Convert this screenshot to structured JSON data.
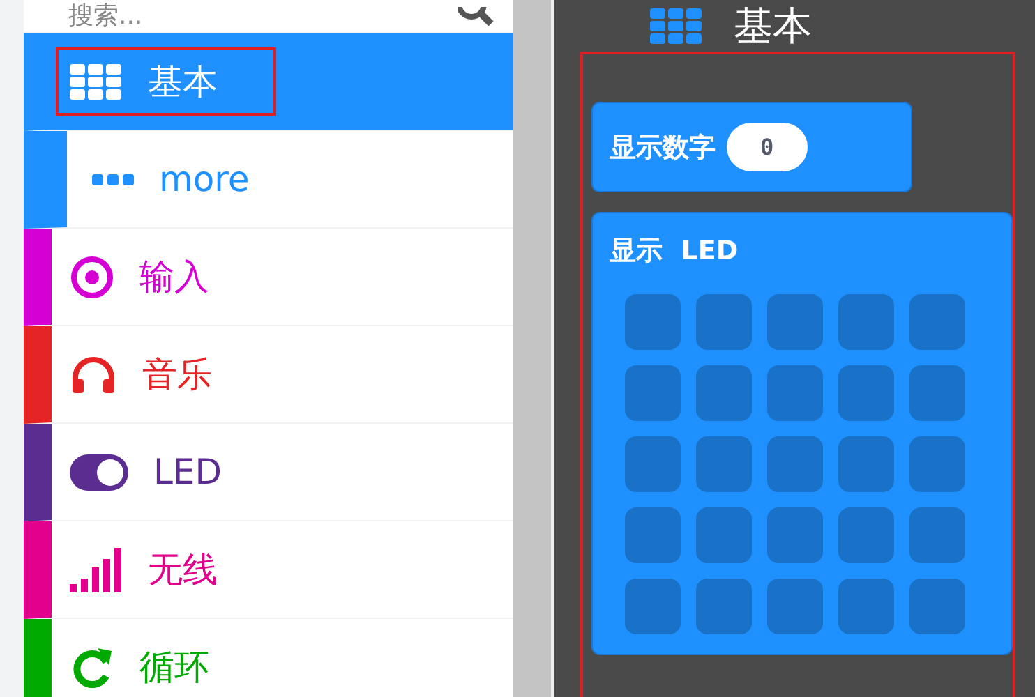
{
  "search": {
    "placeholder": "搜索..."
  },
  "categories": [
    {
      "label": "基本",
      "kind": "grid",
      "color": "#1e90ff",
      "selected": true,
      "sub": false,
      "highlighted": true
    },
    {
      "label": "more",
      "kind": "dots",
      "color": "#1e90ff",
      "selected": false,
      "sub": true,
      "highlighted": false
    },
    {
      "label": "输入",
      "kind": "target",
      "color": "#d400d4",
      "selected": false,
      "sub": false,
      "highlighted": false
    },
    {
      "label": "音乐",
      "kind": "headphones",
      "color": "#e52525",
      "selected": false,
      "sub": false,
      "highlighted": false
    },
    {
      "label": "LED",
      "kind": "toggle",
      "color": "#5c2d91",
      "selected": false,
      "sub": false,
      "highlighted": false
    },
    {
      "label": "无线",
      "kind": "signal",
      "color": "#e3008c",
      "selected": false,
      "sub": false,
      "highlighted": false
    },
    {
      "label": "循环",
      "kind": "refresh",
      "color": "#00aa00",
      "selected": false,
      "sub": false,
      "highlighted": false
    }
  ],
  "flyout": {
    "title": "基本",
    "highlighted": true,
    "blocks": [
      {
        "kind": "number",
        "label": "显示数字",
        "value": "0"
      },
      {
        "kind": "leds",
        "label": "显示  LED"
      }
    ]
  }
}
